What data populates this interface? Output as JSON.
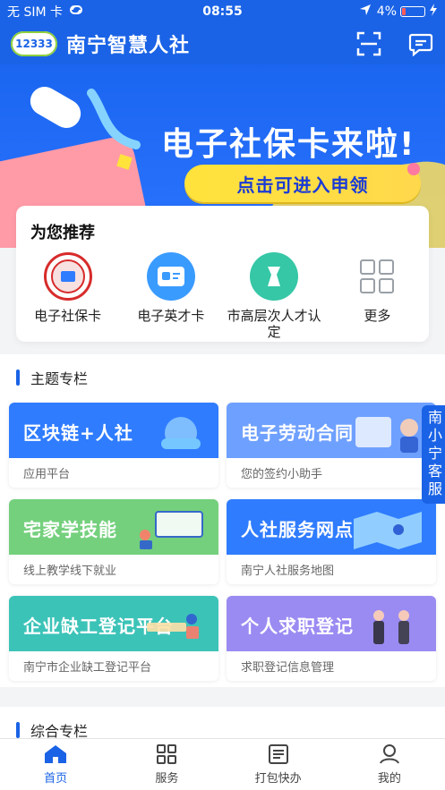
{
  "status": {
    "carrier": "无 SIM 卡",
    "time": "08:55",
    "battery_percent": "4%"
  },
  "app": {
    "title": "南宁智慧人社",
    "logo_text": "12333"
  },
  "banner": {
    "headline": "电子社保卡来啦!",
    "cta": "点击可进入申领"
  },
  "recommend": {
    "title": "为您推荐",
    "items": [
      {
        "label": "电子社保卡",
        "icon": "social-security-seal-icon"
      },
      {
        "label": "电子英才卡",
        "icon": "id-card-icon"
      },
      {
        "label": "市高层次人才认定",
        "icon": "talent-certification-icon"
      },
      {
        "label": "更多",
        "icon": "grid-more-icon"
      }
    ]
  },
  "topics": {
    "title": "主题专栏",
    "cards": [
      {
        "name": "区块链+人社",
        "sub": "应用平台",
        "color": "#2f7cff"
      },
      {
        "name": "电子劳动合同",
        "sub": "您的签约小助手",
        "color": "#6ea0ff"
      },
      {
        "name": "宅家学技能",
        "sub": "线上教学线下就业",
        "color": "#74d07d"
      },
      {
        "name": "人社服务网点",
        "sub": "南宁人社服务地图",
        "color": "#2f7cff"
      },
      {
        "name": "企业缺工登记平台",
        "sub": "南宁市企业缺工登记平台",
        "color": "#3cc3b8"
      },
      {
        "name": "个人求职登记",
        "sub": "求职登记信息管理",
        "color": "#9a8bf2"
      }
    ]
  },
  "composite": {
    "title": "综合专栏"
  },
  "side_tag": "南小宁客服",
  "tabbar": {
    "items": [
      {
        "label": "首页",
        "icon": "home-icon",
        "active": true
      },
      {
        "label": "服务",
        "icon": "services-grid-icon",
        "active": false
      },
      {
        "label": "打包快办",
        "icon": "checklist-icon",
        "active": false
      },
      {
        "label": "我的",
        "icon": "user-icon",
        "active": false
      }
    ]
  },
  "colors": {
    "primary": "#1a63e6",
    "accent_yellow": "#ffe33b"
  }
}
